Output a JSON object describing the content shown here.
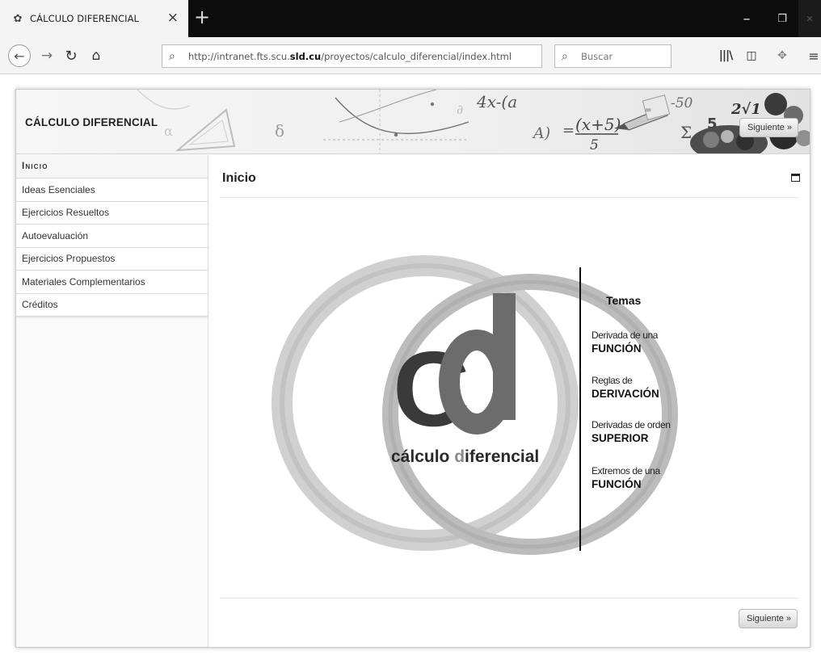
{
  "browser": {
    "tab_title": "CÁLCULO DIFERENCIAL",
    "tab_close": "×",
    "new_tab": "+",
    "url_plain_1": "http://intranet.fts.scu.",
    "url_bold": "sld.cu",
    "url_plain_2": "/proyectos/calculo_diferencial/index.html",
    "search_placeholder": "Buscar"
  },
  "site": {
    "title": "CÁLCULO DIFERENCIAL",
    "next_label": "Siguiente »"
  },
  "sidebar": {
    "items": [
      {
        "label": "Inicio"
      },
      {
        "label": "Ideas Esenciales"
      },
      {
        "label": "Ejercicios Resueltos"
      },
      {
        "label": "Autoevaluación"
      },
      {
        "label": "Ejercicios Propuestos"
      },
      {
        "label": "Materiales Complementarios"
      },
      {
        "label": "Créditos"
      }
    ]
  },
  "main": {
    "title": "Inicio",
    "logo": {
      "letters": "Cd",
      "word1": "cálculo ",
      "word2_initial": "d",
      "word2_rest": "iferencial",
      "topics_heading": "Temas",
      "topics": [
        {
          "label": "Derivada de una",
          "main": "FUNCIÓN"
        },
        {
          "label": "Reglas de",
          "main": "DERIVACIÓN"
        },
        {
          "label": "Derivadas de orden",
          "main": "SUPERIOR"
        },
        {
          "label": "Extremos de una",
          "main": "FUNCIÓN"
        }
      ]
    }
  },
  "banner_formulas": {
    "f1": "4x-(a",
    "f2": "(x+5)",
    "f3": "5",
    "f4": "-50",
    "f5": "δ",
    "f6": "α",
    "f7": "Σ",
    "f8": "2√1",
    "f9": "A)",
    "f10": "=",
    "f11": "∂",
    "f12": "5"
  },
  "colors": {
    "logo_c": "#3a3a3a",
    "logo_d": "#6a6a6a",
    "ring_outer": "#c8c8c8",
    "ring_inner": "#b0b0b0",
    "chrome_dark": "#0c0c0c"
  }
}
